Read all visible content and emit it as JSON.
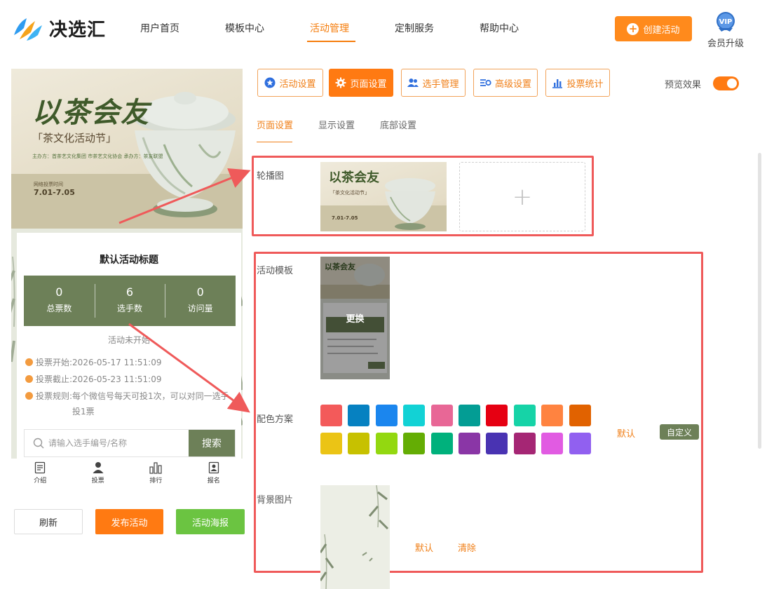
{
  "header": {
    "brand": "决选汇",
    "nav": [
      "用户首页",
      "模板中心",
      "活动管理",
      "定制服务",
      "帮助中心"
    ],
    "nav_active": "活动管理",
    "create_button": "创建活动",
    "vip_badge": "VIP",
    "vip_label": "会员升级"
  },
  "preview": {
    "banner": {
      "title": "以茶会友",
      "subtitle": "「茶文化活动节」",
      "organizers": "主办方：首茶艺文化集团   市茶艺文化协会   承办方：茶友联盟",
      "date_label": "网络投票时间",
      "date_range": "7.01-7.05"
    },
    "activity_title": "默认活动标题",
    "stats": [
      {
        "value": "0",
        "label": "总票数"
      },
      {
        "value": "6",
        "label": "选手数"
      },
      {
        "value": "0",
        "label": "访问量"
      }
    ],
    "status": "活动未开始",
    "vote_start": {
      "key": "投票开始:",
      "value": "2026-05-17 11:51:09"
    },
    "vote_end": {
      "key": "投票截止:",
      "value": "2026-05-23 11:51:09"
    },
    "vote_rule": {
      "key": "投票规则:",
      "value": "每个微信号每天可投1次，可以对同一选手投1票"
    },
    "search_placeholder": "请输入选手编号/名称",
    "search_button": "搜索",
    "tabs": [
      "介绍",
      "投票",
      "排行",
      "报名"
    ]
  },
  "actions": {
    "refresh": "刷新",
    "publish": "发布活动",
    "poster": "活动海报"
  },
  "toolbar": {
    "buttons": [
      "活动设置",
      "页面设置",
      "选手管理",
      "高级设置",
      "投票统计"
    ],
    "active": "页面设置",
    "preview_label": "预览效果",
    "preview_on": true
  },
  "subtabs": {
    "items": [
      "页面设置",
      "显示设置",
      "底部设置"
    ],
    "active": "页面设置"
  },
  "settings": {
    "carousel_label": "轮播图",
    "upload_plus": "+",
    "template_label": "活动模板",
    "template_change": "更换",
    "color_label": "配色方案",
    "colors": [
      "#f35a5a",
      "#0681c1",
      "#1b86ee",
      "#12d2d5",
      "#e86796",
      "#039d94",
      "#e60012",
      "#16d3a7",
      "#ff8340",
      "#e16200",
      "#ebc415",
      "#c7c100",
      "#93d810",
      "#64ad04",
      "#00b17c",
      "#8a36a6",
      "#4933b2",
      "#a52674",
      "#e15be2",
      "#9160f0"
    ],
    "color_default": "默认",
    "color_custom": "自定义",
    "bg_label": "背景图片",
    "bg_default": "默认",
    "bg_clear": "清除"
  }
}
